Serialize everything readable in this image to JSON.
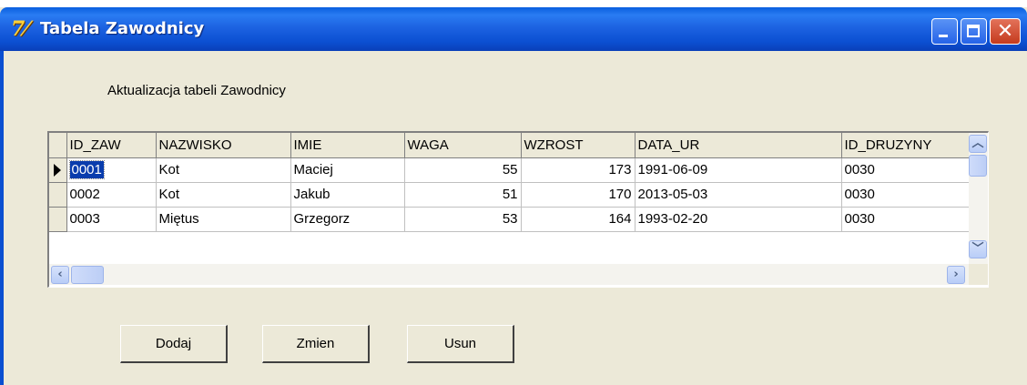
{
  "window": {
    "title": "Tabela Zawodnicy",
    "icon": "delphi-app-icon",
    "buttons": [
      "minimize",
      "maximize",
      "close"
    ]
  },
  "caption": "Aktualizacja tabeli Zawodnicy",
  "table": {
    "columns": [
      "ID_ZAW",
      "NAZWISKO",
      "IMIE",
      "WAGA",
      "WZROST",
      "DATA_UR",
      "ID_DRUZYNY"
    ],
    "rows": [
      [
        "0001",
        "Kot",
        "Maciej",
        "55",
        "173",
        "1991-06-09",
        "0030"
      ],
      [
        "0002",
        "Kot",
        "Jakub",
        "51",
        "170",
        "2013-05-03",
        "0030"
      ],
      [
        "0003",
        "Miętus",
        "Grzegorz",
        "53",
        "164",
        "1993-02-20",
        "0030"
      ]
    ],
    "selected_row": 0
  },
  "actions": {
    "add": "Dodaj",
    "edit": "Zmien",
    "delete": "Usun"
  },
  "colors": {
    "titlebar": "#0a4fd1",
    "face": "#ece9d8",
    "selection": "#0a3dad"
  }
}
